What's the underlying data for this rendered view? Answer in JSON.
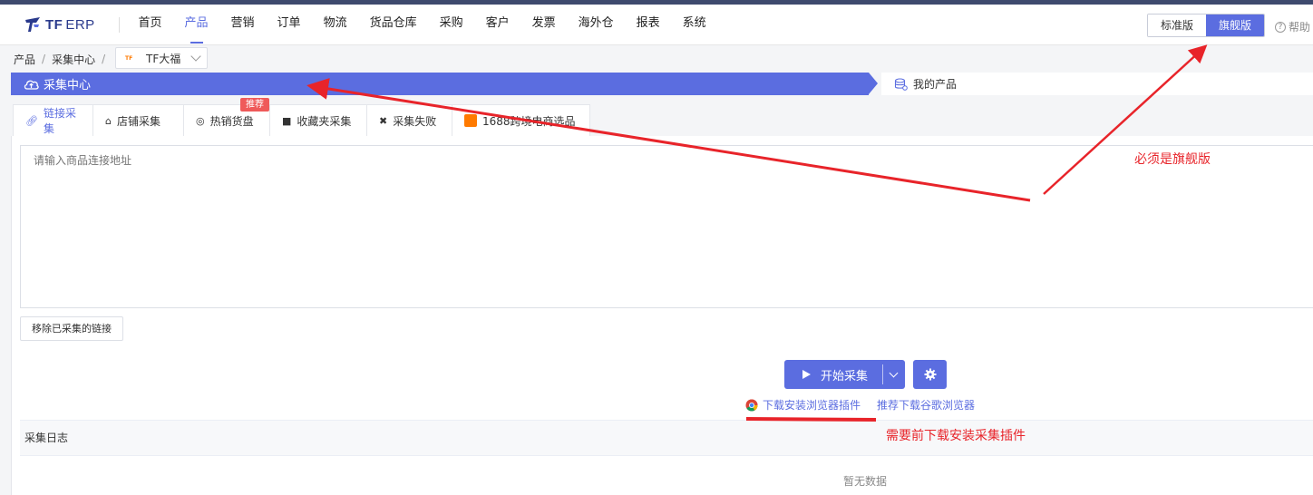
{
  "header": {
    "logo_text": "TF",
    "logo_suffix": "ERP",
    "nav": [
      "首页",
      "产品",
      "营销",
      "订单",
      "物流",
      "货品仓库",
      "采购",
      "客户",
      "发票",
      "海外仓",
      "报表",
      "系统"
    ],
    "active_nav": "产品",
    "edition": {
      "standard": "标准版",
      "flagship": "旗舰版"
    },
    "help": "帮助"
  },
  "breadcrumb": {
    "root": "产品",
    "current": "采集中心"
  },
  "shop_select": {
    "value": "TF大福",
    "logo": "TF"
  },
  "steps": {
    "active": "采集中心",
    "next": "我的产品"
  },
  "tabs": [
    {
      "label": "链接采集",
      "icon": "link-icon"
    },
    {
      "label": "店铺采集",
      "icon": "home-icon"
    },
    {
      "label": "热销货盘",
      "icon": "target-icon"
    },
    {
      "label": "收藏夹采集",
      "icon": "folder-icon"
    },
    {
      "label": "采集失败",
      "icon": "close-circle-icon"
    },
    {
      "label": "1688跨境电商选品",
      "icon": "1688-logo-icon"
    }
  ],
  "tab_badge": "推荐",
  "url_input": {
    "placeholder": "请输入商品连接地址",
    "value": ""
  },
  "remove_button": "移除已采集的链接",
  "start_button": "开始采集",
  "links": {
    "plugin": "下载安装浏览器插件",
    "chrome": "推荐下载谷歌浏览器"
  },
  "log": {
    "title": "采集日志",
    "empty": "暂无数据"
  },
  "annotations": {
    "flagship_note": "必须是旗舰版",
    "plugin_note": "需要前下载安装采集插件"
  },
  "colors": {
    "primary": "#5b6de0",
    "annotation_red": "#e8242a",
    "badge_red": "#ef5a5a"
  }
}
